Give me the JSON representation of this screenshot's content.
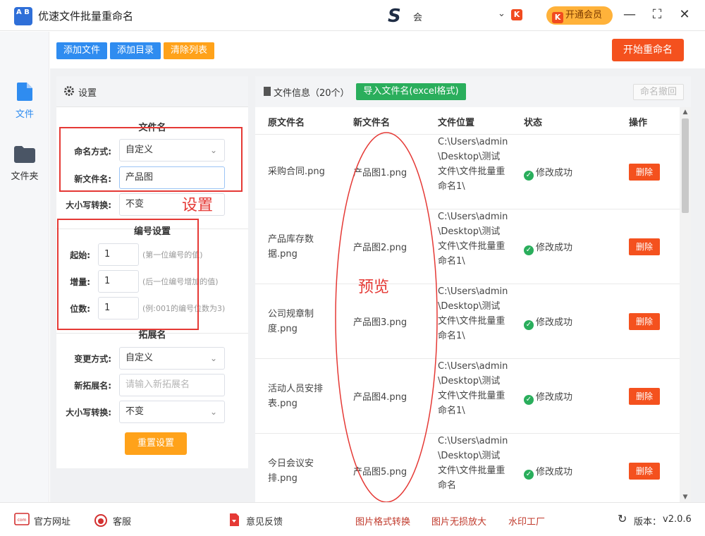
{
  "app": {
    "title": "优速文件批量重命名",
    "logo_text": "A B",
    "user_logo": "S",
    "user_name": "会",
    "vip_mini": "K",
    "vip_label": "开通会员"
  },
  "window_controls": {
    "minimize": "—",
    "maximize": "⛶",
    "close": "✕"
  },
  "nav": [
    {
      "label": "文件",
      "icon": "file-icon",
      "active": true
    },
    {
      "label": "文件夹",
      "icon": "folder-icon",
      "active": false
    }
  ],
  "toolbar": {
    "add_file": "添加文件",
    "add_dir": "添加目录",
    "clear_list": "清除列表",
    "start_rename": "开始重命名"
  },
  "settings": {
    "title": "设置",
    "filename_section": "文件名",
    "naming_mode_label": "命名方式:",
    "naming_mode_value": "自定义",
    "new_name_label": "新文件名:",
    "new_name_value": "产品图",
    "case_label": "大小写转换:",
    "case_value": "不变",
    "number_section": "编号设置",
    "start_label": "起始:",
    "start_value": "1",
    "start_hint": "(第一位编号的值)",
    "step_label": "增量:",
    "step_value": "1",
    "step_hint": "(后一位编号增加的值)",
    "digits_label": "位数:",
    "digits_value": "1",
    "digits_hint": "(例:001的编号位数为3)",
    "ext_section": "拓展名",
    "ext_mode_label": "变更方式:",
    "ext_mode_value": "自定义",
    "new_ext_label": "新拓展名:",
    "new_ext_placeholder": "请输入新拓展名",
    "ext_case_label": "大小写转换:",
    "ext_case_value": "不变",
    "reset": "重置设置"
  },
  "annotations": {
    "settings_note": "设置",
    "preview_note": "预览",
    "color": "#e53935"
  },
  "files": {
    "title": "文件信息（20个）",
    "import_btn": "导入文件名(excel格式)",
    "undo_btn": "命名撤回",
    "columns": [
      "原文件名",
      "新文件名",
      "文件位置",
      "状态",
      "操作"
    ],
    "rows": [
      {
        "orig": "采购合同.png",
        "new": "产品图1.png",
        "path": "C:\\Users\\admin\\Desktop\\测试文件\\文件批量重命名1\\",
        "status": "修改成功",
        "action": "删除"
      },
      {
        "orig": "产品库存数据.png",
        "new": "产品图2.png",
        "path": "C:\\Users\\admin\\Desktop\\测试文件\\文件批量重命名1\\",
        "status": "修改成功",
        "action": "删除"
      },
      {
        "orig": "公司规章制度.png",
        "new": "产品图3.png",
        "path": "C:\\Users\\admin\\Desktop\\测试文件\\文件批量重命名1\\",
        "status": "修改成功",
        "action": "删除"
      },
      {
        "orig": "活动人员安排表.png",
        "new": "产品图4.png",
        "path": "C:\\Users\\admin\\Desktop\\测试文件\\文件批量重命名1\\",
        "status": "修改成功",
        "action": "删除"
      },
      {
        "orig": "今日会议安排.png",
        "new": "产品图5.png",
        "path": "C:\\Users\\admin\\Desktop\\测试文件\\文件批量重命名",
        "status": "修改成功",
        "action": "删除"
      }
    ]
  },
  "footer": {
    "website": "官方网址",
    "service": "客服",
    "feedback": "意见反馈",
    "link1": "图片格式转换",
    "link2": "图片无损放大",
    "link3": "水印工厂",
    "version_label": "版本：",
    "version_value": "v2.0.6",
    "com_badge": "com"
  },
  "colors": {
    "accent_blue": "#2f8cf0",
    "orange": "#ffa21a",
    "danger": "#f4511e",
    "success": "#2aae5c"
  }
}
